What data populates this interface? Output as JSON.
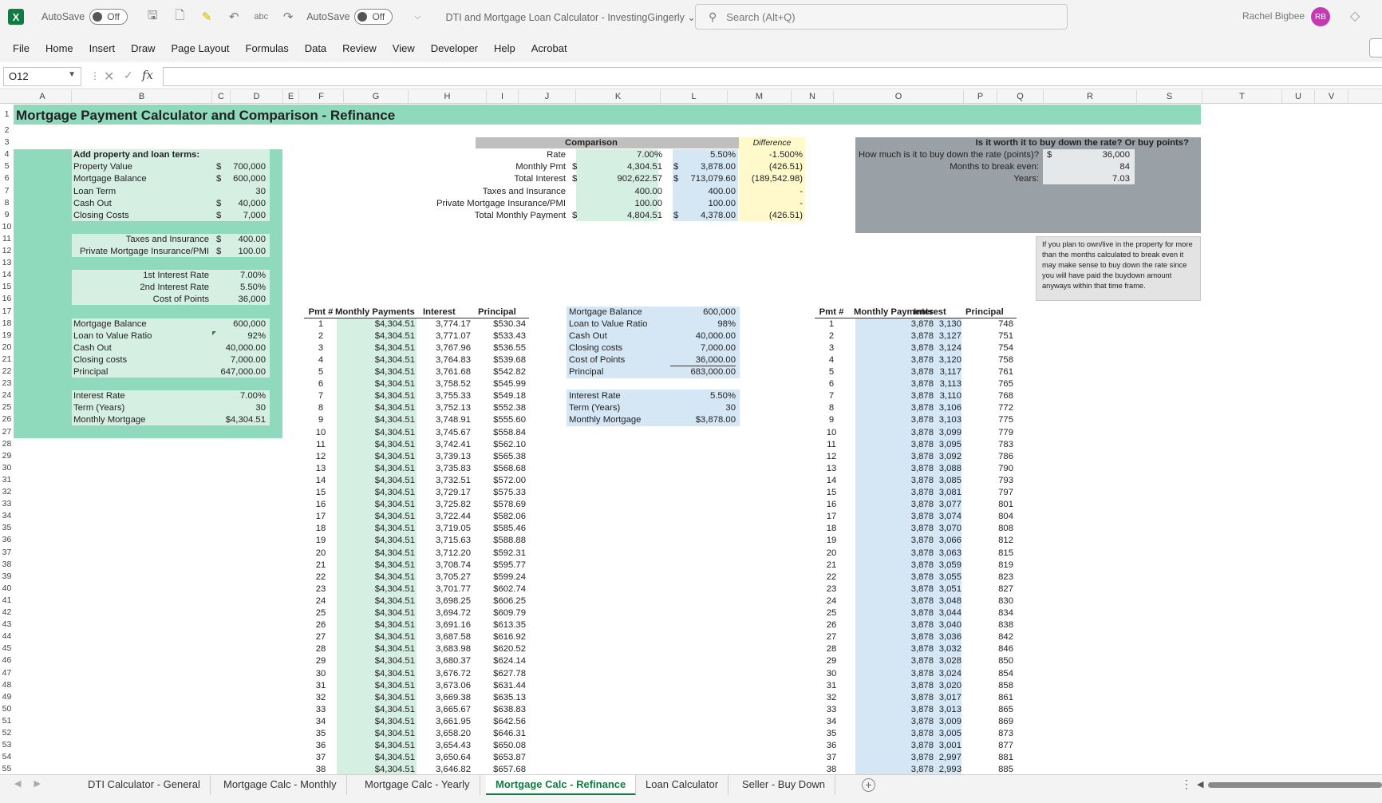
{
  "titlebar": {
    "app_logo": "X",
    "autosave_label_1": "AutoSave",
    "autosave_state_1": "Off",
    "autosave_label_2": "AutoSave",
    "autosave_state_2": "Off",
    "doc_title": "DTI and Mortgage Loan Calculator - InvestingGingerly",
    "search_placeholder": "Search (Alt+Q)",
    "user_name": "Rachel Bigbee",
    "user_initials": "RB"
  },
  "ribbon": {
    "tabs": [
      "File",
      "Home",
      "Insert",
      "Draw",
      "Page Layout",
      "Formulas",
      "Data",
      "Review",
      "View",
      "Developer",
      "Help",
      "Acrobat"
    ]
  },
  "formula_bar": {
    "name_box": "O12",
    "fx": "fx",
    "formula": ""
  },
  "columns": [
    "A",
    "B",
    "C",
    "D",
    "E",
    "F",
    "G",
    "H",
    "I",
    "J",
    "K",
    "L",
    "M",
    "N",
    "O",
    "P",
    "Q",
    "R",
    "S",
    "T",
    "U",
    "V"
  ],
  "sheet": {
    "title": "Mortgage Payment Calculator and Comparison - Refinance",
    "inputs": {
      "header": "Add property and loan terms:",
      "rows": [
        {
          "label": "Property Value",
          "cur": "$",
          "value": "700,000"
        },
        {
          "label": "Mortgage Balance",
          "cur": "$",
          "value": "600,000"
        },
        {
          "label": "Loan Term",
          "cur": "",
          "value": "30"
        },
        {
          "label": "Cash Out",
          "cur": "$",
          "value": "40,000"
        },
        {
          "label": "Closing Costs",
          "cur": "$",
          "value": "7,000"
        }
      ],
      "rows2": [
        {
          "label": "Taxes and Insurance",
          "cur": "$",
          "value": "400.00"
        },
        {
          "label": "Private Mortgage Insurance/PMI",
          "cur": "$",
          "value": "100.00"
        }
      ],
      "rows3": [
        {
          "label": "1st Interest Rate",
          "value": "7.00%"
        },
        {
          "label": "2nd Interest Rate",
          "value": "5.50%"
        },
        {
          "label": "Cost of Points",
          "value": "36,000"
        }
      ],
      "summary": [
        {
          "label": "Mortgage Balance",
          "value": "600,000"
        },
        {
          "label": "Loan to Value Ratio",
          "value": "92%"
        },
        {
          "label": "Cash Out",
          "value": "40,000.00"
        },
        {
          "label": "Closing costs",
          "value": "7,000.00"
        },
        {
          "label": "Principal",
          "value": "647,000.00"
        }
      ],
      "summary2": [
        {
          "label": "Interest Rate",
          "value": "7.00%"
        },
        {
          "label": "Term (Years)",
          "value": "30"
        },
        {
          "label": "Monthly Mortgage",
          "value": "$4,304.51"
        }
      ]
    },
    "comparison": {
      "header": "Comparison",
      "diff_header": "Difference",
      "rows": [
        {
          "label": "Rate",
          "c1": "",
          "v1": "7.00%",
          "c2": "",
          "v2": "5.50%",
          "diff": "-1.500%"
        },
        {
          "label": "Monthly Pmt",
          "c1": "$",
          "v1": "4,304.51",
          "c2": "$",
          "v2": "3,878.00",
          "diff": "(426.51)"
        },
        {
          "label": "Total Interest",
          "c1": "$",
          "v1": "902,622.57",
          "c2": "$",
          "v2": "713,079.60",
          "diff": "(189,542.98)"
        },
        {
          "label": "Taxes and Insurance",
          "c1": "",
          "v1": "400.00",
          "c2": "",
          "v2": "400.00",
          "diff": "-"
        },
        {
          "label": "Private Mortgage Insurance/PMI",
          "c1": "",
          "v1": "100.00",
          "c2": "",
          "v2": "100.00",
          "diff": "-"
        },
        {
          "label": "Total Monthly Payment",
          "c1": "$",
          "v1": "4,804.51",
          "c2": "$",
          "v2": "4,378.00",
          "diff": "(426.51)"
        }
      ]
    },
    "buydown": {
      "header": "Is it worth it to buy down the rate? Or buy points?",
      "rows": [
        {
          "label": "How much is it to buy down the rate (points)?",
          "cur": "$",
          "value": "36,000"
        },
        {
          "label": "Months to break even:",
          "cur": "",
          "value": "84"
        },
        {
          "label": "Years:",
          "cur": "",
          "value": "7.03"
        }
      ],
      "note": "If you plan to own/live in the property for more than the months calculated to break even it may make sense to buy down the rate since you will have paid the buydown amount anyways within that time frame."
    },
    "loan2": {
      "rows": [
        {
          "label": "Mortgage Balance",
          "value": "600,000"
        },
        {
          "label": "Loan to Value Ratio",
          "value": "98%"
        },
        {
          "label": "Cash Out",
          "value": "40,000.00"
        },
        {
          "label": "Closing costs",
          "value": "7,000.00"
        },
        {
          "label": "Cost of Points",
          "value": "36,000.00"
        },
        {
          "label": "Principal",
          "value": "683,000.00"
        }
      ],
      "rows2": [
        {
          "label": "Interest Rate",
          "value": "5.50%"
        },
        {
          "label": "Term (Years)",
          "value": "30"
        },
        {
          "label": "Monthly Mortgage",
          "value": "$3,878.00"
        }
      ]
    },
    "schedule1": {
      "headers": [
        "Pmt #",
        "Monthly Payments",
        "Interest",
        "Principal"
      ],
      "payment": "$4,304.51",
      "interest": [
        "3,774.17",
        "3,771.07",
        "3,767.96",
        "3,764.83",
        "3,761.68",
        "3,758.52",
        "3,755.33",
        "3,752.13",
        "3,748.91",
        "3,745.67",
        "3,742.41",
        "3,739.13",
        "3,735.83",
        "3,732.51",
        "3,729.17",
        "3,725.82",
        "3,722.44",
        "3,719.05",
        "3,715.63",
        "3,712.20",
        "3,708.74",
        "3,705.27",
        "3,701.77",
        "3,698.25",
        "3,694.72",
        "3,691.16",
        "3,687.58",
        "3,683.98",
        "3,680.37",
        "3,676.72",
        "3,673.06",
        "3,669.38",
        "3,665.67",
        "3,661.95",
        "3,658.20",
        "3,654.43",
        "3,650.64",
        "3,646.82"
      ],
      "principal": [
        "$530.34",
        "$533.43",
        "$536.55",
        "$539.68",
        "$542.82",
        "$545.99",
        "$549.18",
        "$552.38",
        "$555.60",
        "$558.84",
        "$562.10",
        "$565.38",
        "$568.68",
        "$572.00",
        "$575.33",
        "$578.69",
        "$582.06",
        "$585.46",
        "$588.88",
        "$592.31",
        "$595.77",
        "$599.24",
        "$602.74",
        "$606.25",
        "$609.79",
        "$613.35",
        "$616.92",
        "$620.52",
        "$624.14",
        "$627.78",
        "$631.44",
        "$635.13",
        "$638.83",
        "$642.56",
        "$646.31",
        "$650.08",
        "$653.87",
        "$657.68"
      ]
    },
    "schedule2": {
      "headers": [
        "Pmt #",
        "Monthly Payments",
        "Interest",
        "Principal"
      ],
      "payment": "3,878",
      "interest": [
        "3,130",
        "3,127",
        "3,124",
        "3,120",
        "3,117",
        "3,113",
        "3,110",
        "3,106",
        "3,103",
        "3,099",
        "3,095",
        "3,092",
        "3,088",
        "3,085",
        "3,081",
        "3,077",
        "3,074",
        "3,070",
        "3,066",
        "3,063",
        "3,059",
        "3,055",
        "3,051",
        "3,048",
        "3,044",
        "3,040",
        "3,036",
        "3,032",
        "3,028",
        "3,024",
        "3,020",
        "3,017",
        "3,013",
        "3,009",
        "3,005",
        "3,001",
        "2,997",
        "2,993"
      ],
      "principal": [
        "748",
        "751",
        "754",
        "758",
        "761",
        "765",
        "768",
        "772",
        "775",
        "779",
        "783",
        "786",
        "790",
        "793",
        "797",
        "801",
        "804",
        "808",
        "812",
        "815",
        "819",
        "823",
        "827",
        "830",
        "834",
        "838",
        "842",
        "846",
        "850",
        "854",
        "858",
        "861",
        "865",
        "869",
        "873",
        "877",
        "881",
        "885"
      ]
    }
  },
  "sheet_tabs": [
    "DTI Calculator - General",
    "Mortgage Calc - Monthly",
    "Mortgage Calc - Yearly",
    "Mortgage Calc - Refinance",
    "Loan Calculator",
    "Seller - Buy Down"
  ],
  "active_sheet": "Mortgage Calc - Refinance",
  "colors": {
    "excel_green": "#107c41",
    "title_band": "#8fd9bc",
    "input_green": "#d6efe3",
    "blue_fill": "#d5e6f5",
    "yellow_fill": "#fff9cc",
    "gray_header": "#bfbfbf",
    "gray_panel": "#9aa1a6"
  }
}
